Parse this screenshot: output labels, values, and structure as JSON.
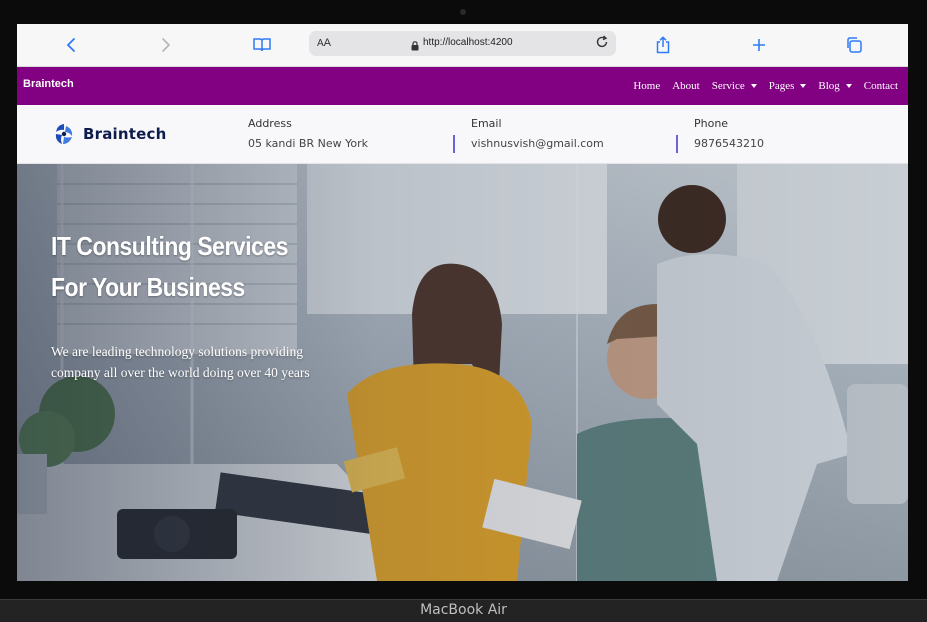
{
  "device": {
    "model_label": "MacBook Air"
  },
  "browser": {
    "text_size_label_small": "A",
    "text_size_label_large": "A",
    "url": "http://localhost:4200",
    "icons": [
      "back-icon",
      "forward-icon",
      "bookmarks-icon",
      "lock-icon",
      "reload-icon",
      "share-icon",
      "new-tab-icon",
      "tabs-icon"
    ]
  },
  "site": {
    "brand": "Braintech",
    "nav": [
      {
        "label": "Home",
        "dropdown": false
      },
      {
        "label": "About",
        "dropdown": false
      },
      {
        "label": "Service",
        "dropdown": true
      },
      {
        "label": "Pages",
        "dropdown": true
      },
      {
        "label": "Blog",
        "dropdown": true
      },
      {
        "label": "Contact",
        "dropdown": false
      }
    ],
    "logo_text": "Braintech",
    "contact": {
      "address_label": "Address",
      "address_value": "05 kandi BR New York",
      "email_label": "Email",
      "email_value": "vishnusvish@gmail.com",
      "phone_label": "Phone",
      "phone_value": "9876543210"
    },
    "hero": {
      "title_line1": "IT Consulting Services",
      "title_line2": "For Your Business",
      "subtitle": "We are leading technology solutions providing company all over the world doing over 40 years"
    }
  },
  "colors": {
    "navbar": "#820082",
    "divider_accent": "#6b63d6",
    "logo_blue": "#1e4bb8",
    "browser_icon_blue": "#2f7bf5"
  }
}
